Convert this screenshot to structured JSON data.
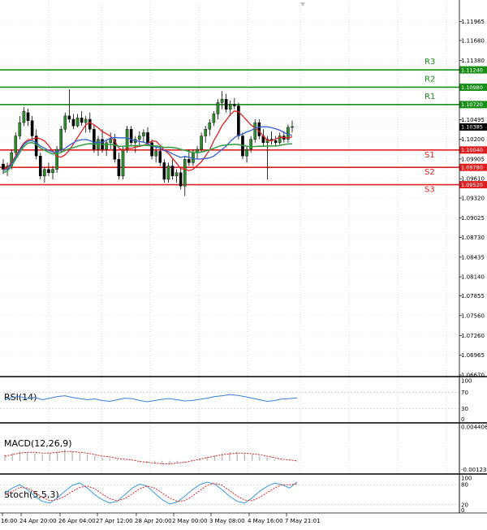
{
  "chart_data": {
    "type": "candlestick",
    "y_ticks": [
      "1.11965",
      "1.11680",
      "1.11380",
      "1.11240",
      "1.10980",
      "1.10720",
      "1.10495",
      "1.10385",
      "1.10200",
      "1.10040",
      "1.09905",
      "1.09780",
      "1.09610",
      "1.09520",
      "1.09320",
      "1.09025",
      "1.08730",
      "1.08435",
      "1.08140",
      "1.07855",
      "1.07560",
      "1.07260",
      "1.06965",
      "1.06670"
    ],
    "ylim": [
      1.0667,
      1.1225
    ],
    "x_ticks": [
      "16:00",
      "24 Apr 20:00",
      "26 Apr 04:00",
      "27 Apr 12:00",
      "28 Apr 20:00",
      "2 May 00:00",
      "3 May 08:00",
      "4 May 16:00",
      "7 May 21:01"
    ],
    "current_price": "1.10385",
    "levels": [
      {
        "name": "R3",
        "value": 1.1124,
        "label": "1.11240",
        "color": "#1a8f1a"
      },
      {
        "name": "R2",
        "value": 1.1098,
        "label": "1.10980",
        "color": "#1a8f1a"
      },
      {
        "name": "R1",
        "value": 1.1072,
        "label": "1.10720",
        "color": "#1a8f1a"
      },
      {
        "name": "S1",
        "value": 1.1004,
        "label": "1.10040",
        "color": "#e02020"
      },
      {
        "name": "S2",
        "value": 1.0978,
        "label": "1.09780",
        "color": "#e02020"
      },
      {
        "name": "S3",
        "value": 1.0952,
        "label": "1.09520",
        "color": "#e02020"
      }
    ],
    "candles": [
      [
        1.0983,
        1.099,
        1.0968,
        1.0975
      ],
      [
        1.0975,
        1.0985,
        1.0965,
        1.098
      ],
      [
        1.098,
        1.1005,
        1.0975,
        1.1
      ],
      [
        1.1,
        1.103,
        1.0995,
        1.1025
      ],
      [
        1.1025,
        1.1055,
        1.102,
        1.1045
      ],
      [
        1.1045,
        1.1068,
        1.104,
        1.1062
      ],
      [
        1.106,
        1.1066,
        1.104,
        1.1048
      ],
      [
        1.1048,
        1.1055,
        1.102,
        1.1025
      ],
      [
        1.1025,
        1.1035,
        1.099,
        1.0995
      ],
      [
        1.0995,
        1.1,
        1.096,
        1.0965
      ],
      [
        1.0965,
        1.0978,
        1.0955,
        1.0975
      ],
      [
        1.0975,
        1.0985,
        1.0965,
        1.097
      ],
      [
        1.097,
        1.098,
        1.096,
        1.0975
      ],
      [
        1.0975,
        1.101,
        1.097,
        1.1005
      ],
      [
        1.1005,
        1.104,
        1.1,
        1.1035
      ],
      [
        1.1035,
        1.106,
        1.103,
        1.1055
      ],
      [
        1.1055,
        1.1095,
        1.1045,
        1.105
      ],
      [
        1.105,
        1.1058,
        1.1035,
        1.104
      ],
      [
        1.104,
        1.1058,
        1.1038,
        1.1052
      ],
      [
        1.1052,
        1.1062,
        1.104,
        1.1045
      ],
      [
        1.1045,
        1.1055,
        1.103,
        1.105
      ],
      [
        1.105,
        1.106,
        1.103,
        1.1035
      ],
      [
        1.1035,
        1.1042,
        1.1,
        1.1005
      ],
      [
        1.1005,
        1.1025,
        1.0995,
        1.102
      ],
      [
        1.102,
        1.1035,
        1.1,
        1.1005
      ],
      [
        1.1005,
        1.102,
        1.0995,
        1.1015
      ],
      [
        1.1015,
        1.103,
        1.1005,
        1.102
      ],
      [
        1.102,
        1.1028,
        1.0985,
        1.099
      ],
      [
        1.099,
        1.1,
        1.096,
        1.0965
      ],
      [
        1.0965,
        1.101,
        1.096,
        1.1005
      ],
      [
        1.1005,
        1.104,
        1.1,
        1.1035
      ],
      [
        1.1035,
        1.104,
        1.101,
        1.1015
      ],
      [
        1.1015,
        1.1025,
        1.1,
        1.102
      ],
      [
        1.102,
        1.1032,
        1.101,
        1.1025
      ],
      [
        1.1025,
        1.1035,
        1.1015,
        1.103
      ],
      [
        1.103,
        1.1038,
        1.101,
        1.1015
      ],
      [
        1.1015,
        1.102,
        1.099,
        1.0995
      ],
      [
        1.0995,
        1.1008,
        1.0985,
        1.1002
      ],
      [
        1.1002,
        1.101,
        1.098,
        1.0985
      ],
      [
        1.0985,
        1.099,
        1.0955,
        1.096
      ],
      [
        1.096,
        1.0985,
        1.0955,
        1.098
      ],
      [
        1.098,
        1.099,
        1.096,
        1.0965
      ],
      [
        1.0965,
        1.0975,
        1.0955,
        1.097
      ],
      [
        1.097,
        1.0978,
        1.0945,
        1.095
      ],
      [
        1.095,
        1.0995,
        1.0935,
        1.099
      ],
      [
        1.099,
        1.1005,
        1.098,
        1.0985
      ],
      [
        1.0985,
        1.1005,
        1.098,
        1.1
      ],
      [
        1.1,
        1.101,
        1.099,
        1.1005
      ],
      [
        1.1005,
        1.103,
        1.1,
        1.1025
      ],
      [
        1.1025,
        1.104,
        1.1015,
        1.1035
      ],
      [
        1.1035,
        1.105,
        1.1025,
        1.1045
      ],
      [
        1.1045,
        1.1062,
        1.104,
        1.1058
      ],
      [
        1.1058,
        1.108,
        1.105,
        1.1075
      ],
      [
        1.1075,
        1.1092,
        1.1065,
        1.108
      ],
      [
        1.108,
        1.1088,
        1.106,
        1.1065
      ],
      [
        1.1065,
        1.1078,
        1.1055,
        1.1072
      ],
      [
        1.1072,
        1.1082,
        1.1065,
        1.107
      ],
      [
        1.107,
        1.1075,
        1.102,
        1.1025
      ],
      [
        1.1025,
        1.103,
        1.099,
        1.0995
      ],
      [
        1.0995,
        1.101,
        1.0985,
        1.1005
      ],
      [
        1.1005,
        1.1025,
        1.1,
        1.102
      ],
      [
        1.102,
        1.105,
        1.1015,
        1.1045
      ],
      [
        1.1045,
        1.105,
        1.102,
        1.1025
      ],
      [
        1.1025,
        1.1035,
        1.101,
        1.1015
      ],
      [
        1.1015,
        1.1025,
        1.096,
        1.102
      ],
      [
        1.102,
        1.1032,
        1.1012,
        1.1018
      ],
      [
        1.1018,
        1.1025,
        1.101,
        1.1015
      ],
      [
        1.1015,
        1.103,
        1.1012,
        1.1025
      ],
      [
        1.1025,
        1.1032,
        1.1015,
        1.102
      ],
      [
        1.102,
        1.1042,
        1.1015,
        1.1038
      ],
      [
        1.1038,
        1.1048,
        1.103,
        1.1039
      ]
    ],
    "indicators": [
      {
        "name": "RSI(14)",
        "ticks": [
          "100",
          "70",
          "30",
          "0"
        ],
        "ylim": [
          0,
          100
        ],
        "guides": [
          70,
          30
        ],
        "values": [
          52,
          58,
          60,
          55,
          58,
          52,
          56,
          60,
          62,
          58,
          55,
          52,
          54,
          50,
          48,
          52,
          56,
          55,
          50,
          47,
          50,
          53,
          55,
          52,
          49,
          50,
          53,
          56,
          60,
          62,
          65,
          63,
          60,
          56,
          52,
          48,
          50,
          54,
          55,
          57
        ]
      },
      {
        "name": "MACD(12,26,9)",
        "ticks": [
          "0.004406",
          "-0.001237"
        ],
        "ylim": [
          -0.0013,
          0.0044
        ],
        "histogram": [
          0.0008,
          0.001,
          0.0012,
          0.0011,
          0.0009,
          0.0008,
          0.001,
          0.0013,
          0.0014,
          0.0012,
          0.001,
          0.0008,
          0.0006,
          0.0004,
          0.0003,
          0.0002,
          0.0001,
          0.0,
          -0.0002,
          -0.0003,
          -0.0004,
          -0.0005,
          -0.0004,
          -0.0003,
          -0.0001,
          0.0001,
          0.0003,
          0.0005,
          0.0007,
          0.0009,
          0.0011,
          0.0012,
          0.001,
          0.0008,
          0.0006,
          0.0004,
          0.0002,
          0.0001,
          0.0,
          -0.0001
        ],
        "signal": [
          0.0006,
          0.0008,
          0.001,
          0.0011,
          0.0011,
          0.001,
          0.001,
          0.0011,
          0.0012,
          0.0012,
          0.0011,
          0.001,
          0.0008,
          0.0006,
          0.0005,
          0.0003,
          0.0002,
          0.0001,
          -0.0001,
          -0.0002,
          -0.0003,
          -0.0004,
          -0.0004,
          -0.0003,
          -0.0002,
          0.0,
          0.0002,
          0.0004,
          0.0006,
          0.0008,
          0.0009,
          0.001,
          0.001,
          0.0009,
          0.0008,
          0.0006,
          0.0004,
          0.0002,
          0.0001,
          0.0
        ]
      },
      {
        "name": "Stoch(5,5,3)",
        "ticks": [
          "100",
          "80",
          "20",
          "0"
        ],
        "ylim": [
          0,
          100
        ],
        "guides": [
          80,
          20
        ],
        "k": [
          55,
          70,
          80,
          65,
          45,
          30,
          25,
          40,
          60,
          78,
          85,
          70,
          50,
          35,
          25,
          30,
          50,
          70,
          82,
          75,
          55,
          35,
          22,
          28,
          45,
          65,
          80,
          88,
          82,
          65,
          45,
          30,
          25,
          40,
          60,
          75,
          85,
          80,
          70,
          88
        ],
        "d": [
          50,
          60,
          72,
          70,
          58,
          42,
          32,
          35,
          45,
          60,
          72,
          76,
          68,
          52,
          38,
          32,
          38,
          52,
          68,
          76,
          70,
          55,
          40,
          30,
          32,
          45,
          62,
          78,
          84,
          78,
          62,
          46,
          34,
          32,
          42,
          56,
          70,
          80,
          80,
          82
        ]
      }
    ]
  }
}
